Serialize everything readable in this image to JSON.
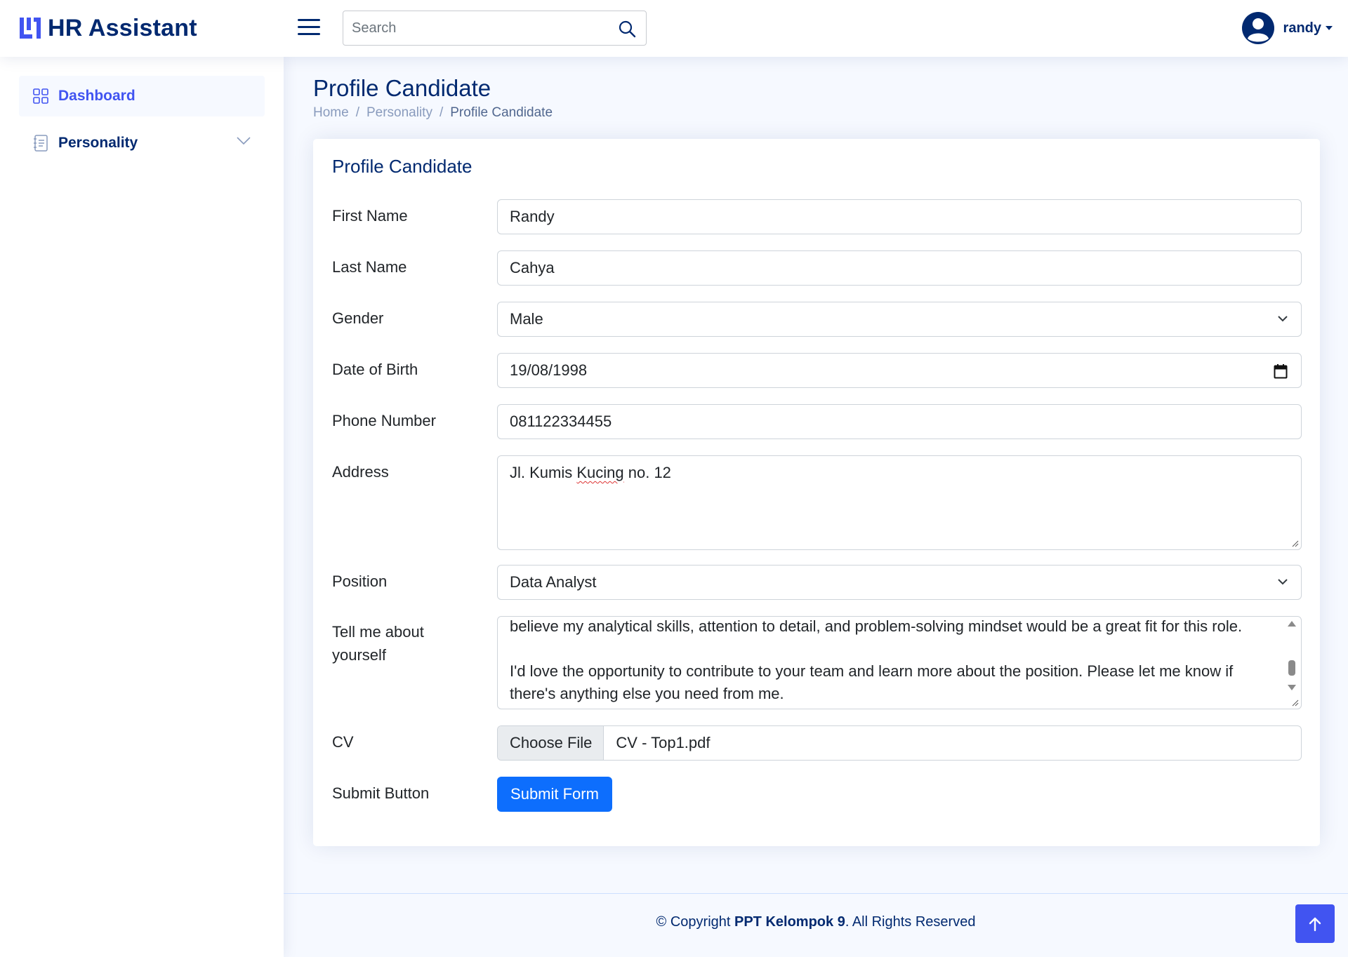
{
  "header": {
    "app_title": "HR Assistant",
    "search_placeholder": "Search",
    "user_name": "randy"
  },
  "sidebar": {
    "items": [
      {
        "label": "Dashboard",
        "icon": "grid-icon",
        "active": true
      },
      {
        "label": "Personality",
        "icon": "journal-text-icon",
        "has_submenu": true
      }
    ]
  },
  "page": {
    "title": "Profile Candidate",
    "breadcrumb": [
      "Home",
      "Personality",
      "Profile Candidate"
    ]
  },
  "form": {
    "title": "Profile Candidate",
    "first_name": {
      "label": "First Name",
      "value": "Randy"
    },
    "last_name": {
      "label": "Last Name",
      "value": "Cahya"
    },
    "gender": {
      "label": "Gender",
      "value": "Male"
    },
    "dob": {
      "label": "Date of Birth",
      "value": "19/08/1998"
    },
    "phone": {
      "label": "Phone Number",
      "value": "081122334455"
    },
    "address": {
      "label": "Address",
      "value_before": "Jl. Kumis ",
      "value_misspelled": "Kucing",
      "value_after": " no. 12"
    },
    "position": {
      "label": "Position",
      "value": "Data Analyst"
    },
    "about": {
      "label": "Tell me about yourself",
      "line1": "believe my analytical skills, attention to detail, and problem-solving mindset would be a great fit for this role.",
      "line2": "I'd love the opportunity to contribute to your team and learn more about the position. Please let me know if there's anything else you need from me."
    },
    "cv": {
      "label": "CV",
      "button": "Choose File",
      "file_name": "CV - Top1.pdf"
    },
    "submit": {
      "label": "Submit Button",
      "button": "Submit Form"
    }
  },
  "footer": {
    "prefix": "© Copyright ",
    "org": "PPT Kelompok 9",
    "suffix": ". All Rights Reserved"
  },
  "colors": {
    "brand": "#012970",
    "accent": "#4154f1",
    "primary_button": "#0d6efd",
    "background": "#f6f9ff"
  }
}
